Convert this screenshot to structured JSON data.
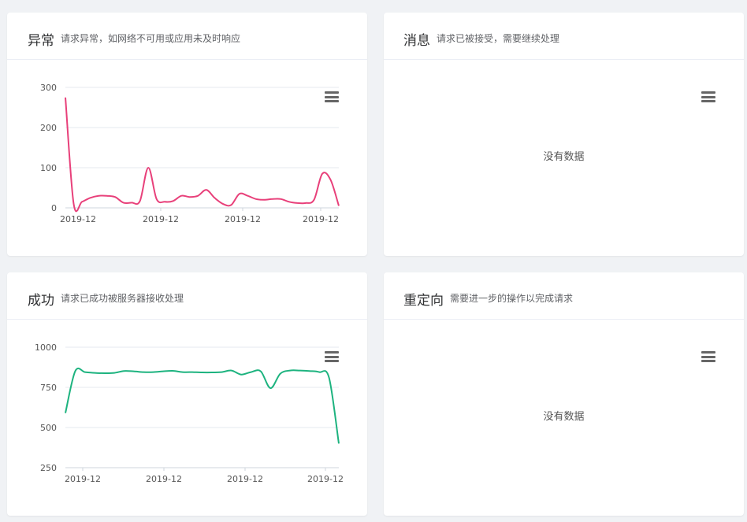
{
  "cards": {
    "abnormal": {
      "title": "异常",
      "subtitle": "请求异常，如网络不可用或应用未及时响应"
    },
    "message": {
      "title": "消息",
      "subtitle": "请求已被接受，需要继续处理",
      "empty_text": "没有数据"
    },
    "success": {
      "title": "成功",
      "subtitle": "请求已成功被服务器接收处理"
    },
    "redirect": {
      "title": "重定向",
      "subtitle": "需要进一步的操作以完成请求",
      "empty_text": "没有数据"
    }
  },
  "icons": {
    "menu": "hamburger-menu-icon"
  },
  "colors": {
    "abnormal_line": "#e8407a",
    "success_line": "#1db37f"
  },
  "chart_data": [
    {
      "type": "line",
      "title": "",
      "ylim": [
        0,
        300
      ],
      "yticks": [
        0,
        100,
        200,
        300
      ],
      "xtick_labels": [
        "2019-12",
        "2019-12",
        "2019-12",
        "2019-12"
      ],
      "series": [
        {
          "values": [
            275,
            10,
            15,
            25,
            30,
            30,
            27,
            13,
            13,
            17,
            100,
            22,
            15,
            17,
            30,
            27,
            30,
            45,
            25,
            10,
            7,
            35,
            30,
            22,
            20,
            22,
            22,
            15,
            12,
            12,
            20,
            85,
            70,
            5
          ]
        }
      ]
    },
    {
      "type": "line",
      "title": "",
      "ylim": [
        250,
        1000
      ],
      "yticks": [
        250,
        500,
        750,
        1000
      ],
      "xtick_labels": [
        "2019-12",
        "2019-12",
        "2019-12",
        "2019-12"
      ],
      "series": [
        {
          "values": [
            590,
            850,
            845,
            840,
            838,
            840,
            852,
            850,
            845,
            845,
            850,
            853,
            845,
            845,
            843,
            843,
            845,
            855,
            830,
            845,
            850,
            745,
            835,
            855,
            855,
            852,
            845,
            810,
            400
          ]
        }
      ]
    }
  ]
}
